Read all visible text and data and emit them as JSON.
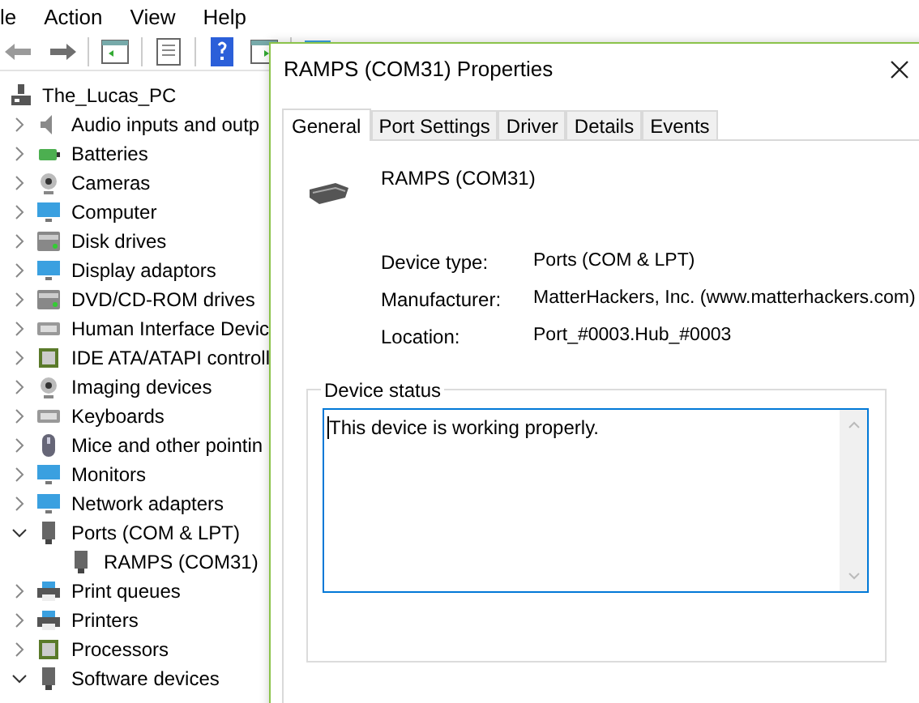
{
  "menu": [
    "le",
    "Action",
    "View",
    "Help"
  ],
  "tree": {
    "label": "The_Lucas_PC",
    "items": [
      {
        "label": "Audio inputs and outp",
        "kind": "speaker",
        "expanded": false
      },
      {
        "label": "Batteries",
        "kind": "battery",
        "expanded": false
      },
      {
        "label": "Cameras",
        "kind": "camera",
        "expanded": false
      },
      {
        "label": "Computer",
        "kind": "monitor",
        "expanded": false
      },
      {
        "label": "Disk drives",
        "kind": "drive",
        "expanded": false
      },
      {
        "label": "Display adaptors",
        "kind": "monitor",
        "expanded": false
      },
      {
        "label": "DVD/CD-ROM drives",
        "kind": "drive",
        "expanded": false
      },
      {
        "label": "Human Interface Devic",
        "kind": "keyboard",
        "expanded": false
      },
      {
        "label": "IDE ATA/ATAPI controll",
        "kind": "chip",
        "expanded": false
      },
      {
        "label": "Imaging devices",
        "kind": "camera",
        "expanded": false
      },
      {
        "label": "Keyboards",
        "kind": "keyboard",
        "expanded": false
      },
      {
        "label": "Mice and other pointin",
        "kind": "mouse",
        "expanded": false
      },
      {
        "label": "Monitors",
        "kind": "monitor",
        "expanded": false
      },
      {
        "label": "Network adapters",
        "kind": "monitor",
        "expanded": false
      },
      {
        "label": "Ports (COM & LPT)",
        "kind": "port",
        "expanded": true,
        "children": [
          {
            "label": "RAMPS (COM31)",
            "kind": "port"
          }
        ]
      },
      {
        "label": "Print queues",
        "kind": "printer",
        "expanded": false
      },
      {
        "label": "Printers",
        "kind": "printer",
        "expanded": false
      },
      {
        "label": "Processors",
        "kind": "chip",
        "expanded": false
      },
      {
        "label": "Software devices",
        "kind": "port",
        "expanded": true
      }
    ]
  },
  "dialog": {
    "title": "RAMPS (COM31) Properties",
    "tabs": [
      {
        "label": "General",
        "selected": true
      },
      {
        "label": "Port Settings",
        "selected": false
      },
      {
        "label": "Driver",
        "selected": false
      },
      {
        "label": "Details",
        "selected": false
      },
      {
        "label": "Events",
        "selected": false
      }
    ],
    "device_name": "RAMPS (COM31)",
    "properties": [
      {
        "label": "Device type:",
        "value": "Ports (COM & LPT)"
      },
      {
        "label": "Manufacturer:",
        "value": "MatterHackers, Inc. (www.matterhackers.com)"
      },
      {
        "label": "Location:",
        "value": "Port_#0003.Hub_#0003"
      }
    ],
    "status_group": {
      "title": "Device status",
      "text": "This device is working properly."
    }
  }
}
